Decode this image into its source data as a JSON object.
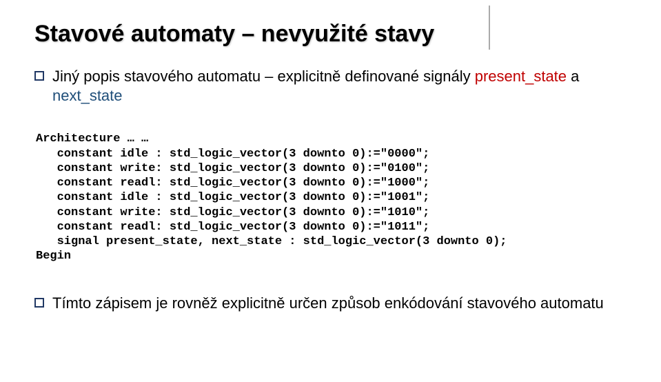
{
  "title": "Stavové automaty – nevyužité stavy",
  "bullet1": {
    "prefix": "Jiný popis stavového automatu – explicitně definované signály ",
    "span_red": "present_state",
    "mid": " a ",
    "span_blue": "next_state"
  },
  "code": {
    "l0": "Architecture … …",
    "l1": "   constant idle : std_logic_vector(3 downto 0):=\"0000\";",
    "l2": "   constant write: std_logic_vector(3 downto 0):=\"0100\";",
    "l3": "   constant readl: std_logic_vector(3 downto 0):=\"1000\";",
    "l4": "   constant idle : std_logic_vector(3 downto 0):=\"1001\";",
    "l5": "   constant write: std_logic_vector(3 downto 0):=\"1010\";",
    "l6": "   constant readl: std_logic_vector(3 downto 0):=\"1011\";",
    "l7": "   signal present_state, next_state : std_logic_vector(3 downto 0);",
    "l8": "Begin"
  },
  "bullet2": "Tímto zápisem je rovněž explicitně určen způsob enkódování stavového automatu"
}
